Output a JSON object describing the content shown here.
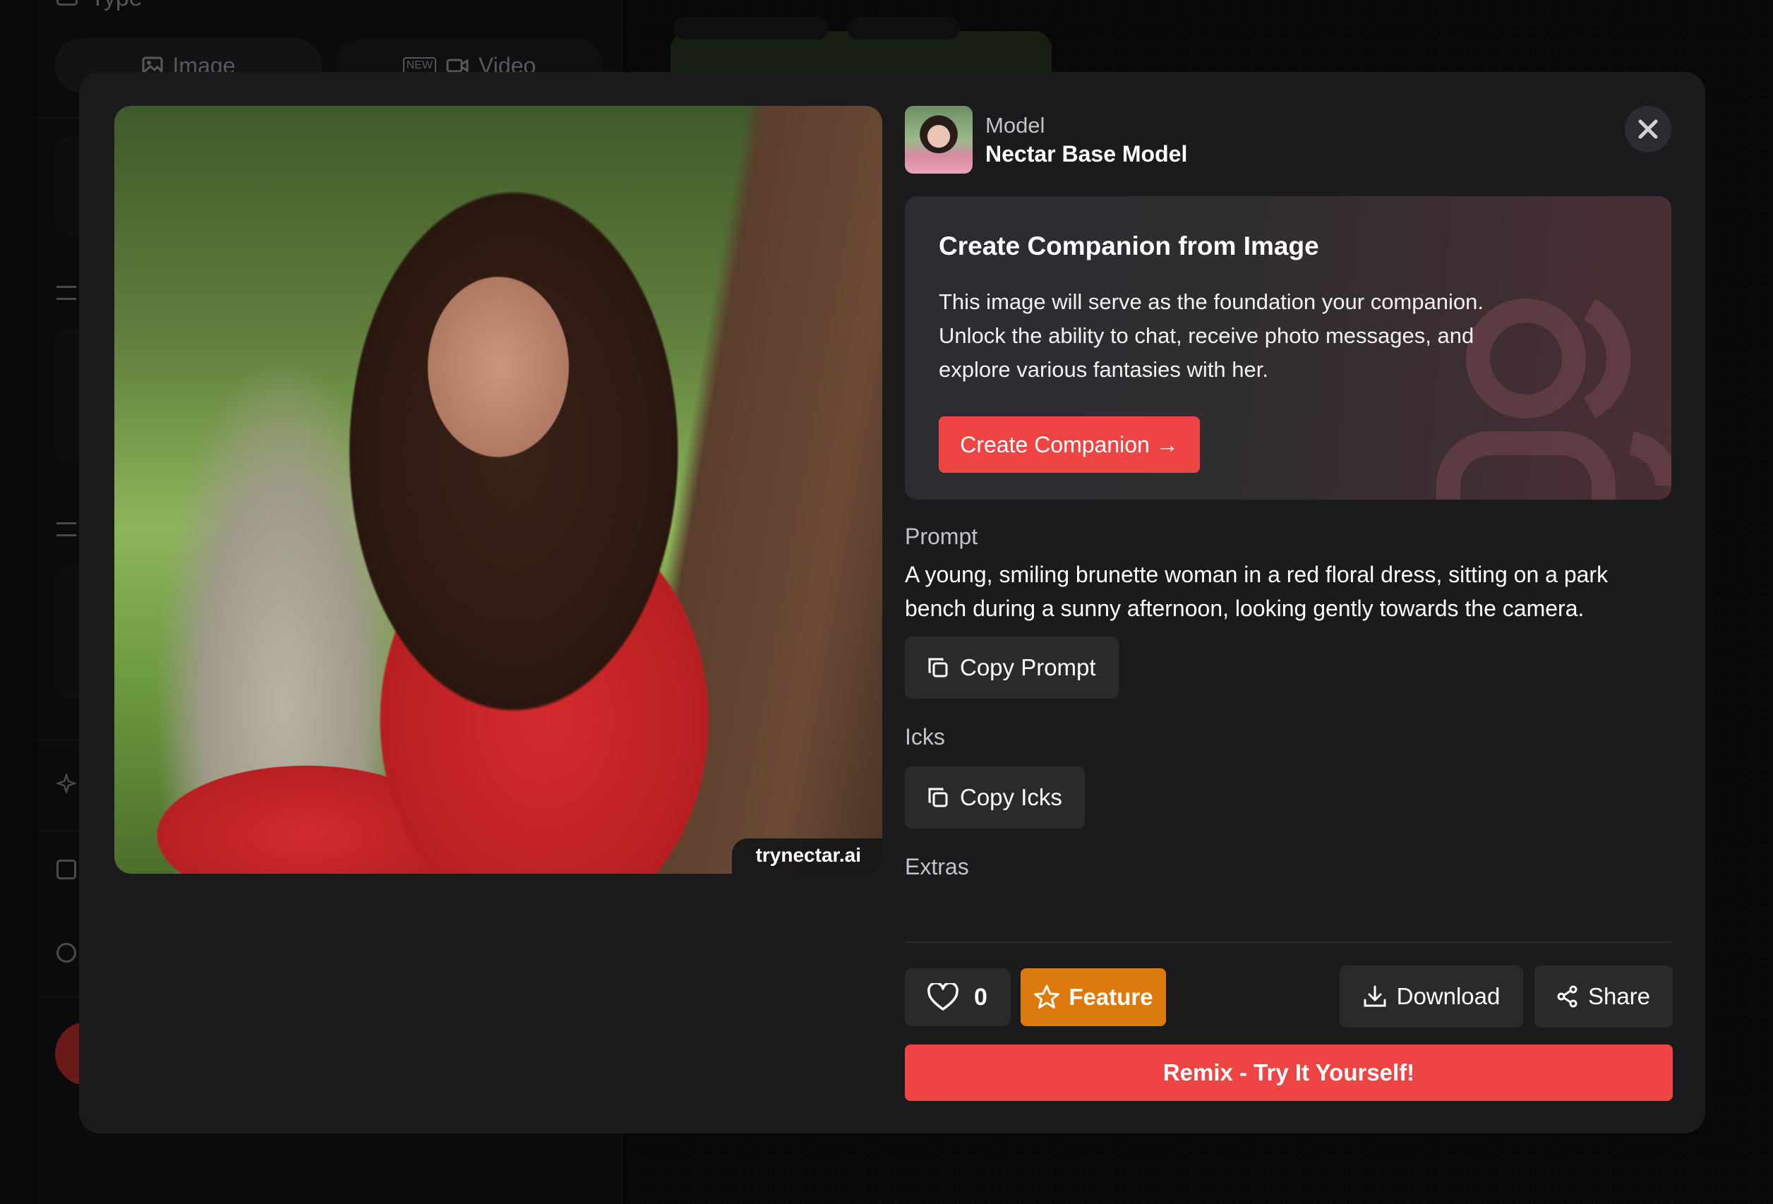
{
  "background": {
    "type_label": "Type",
    "tabs": [
      {
        "label": "Image"
      },
      {
        "label": "Video",
        "badge": "NEW"
      }
    ]
  },
  "modal": {
    "watermark": "trynectar.ai",
    "model": {
      "label": "Model",
      "name": "Nectar Base Model"
    },
    "companion_card": {
      "title": "Create Companion from Image",
      "description": "This image will serve as the foundation your companion. Unlock the ability to chat, receive photo messages, and explore various fantasies with her.",
      "button_label": "Create Companion →"
    },
    "prompt": {
      "label": "Prompt",
      "text": "A young, smiling brunette woman in a red floral dress, sitting on a park bench during a sunny afternoon, looking gently towards the camera.",
      "copy_label": "Copy Prompt"
    },
    "icks": {
      "label": "Icks",
      "copy_label": "Copy Icks"
    },
    "extras": {
      "label": "Extras"
    },
    "actions": {
      "like_count": "0",
      "feature_label": "Feature",
      "download_label": "Download",
      "share_label": "Share",
      "remix_label": "Remix - Try It Yourself!"
    },
    "colors": {
      "accent_red": "#ef4444",
      "feature_orange": "#dd7a0e",
      "modal_bg": "#1b1b1d"
    }
  }
}
